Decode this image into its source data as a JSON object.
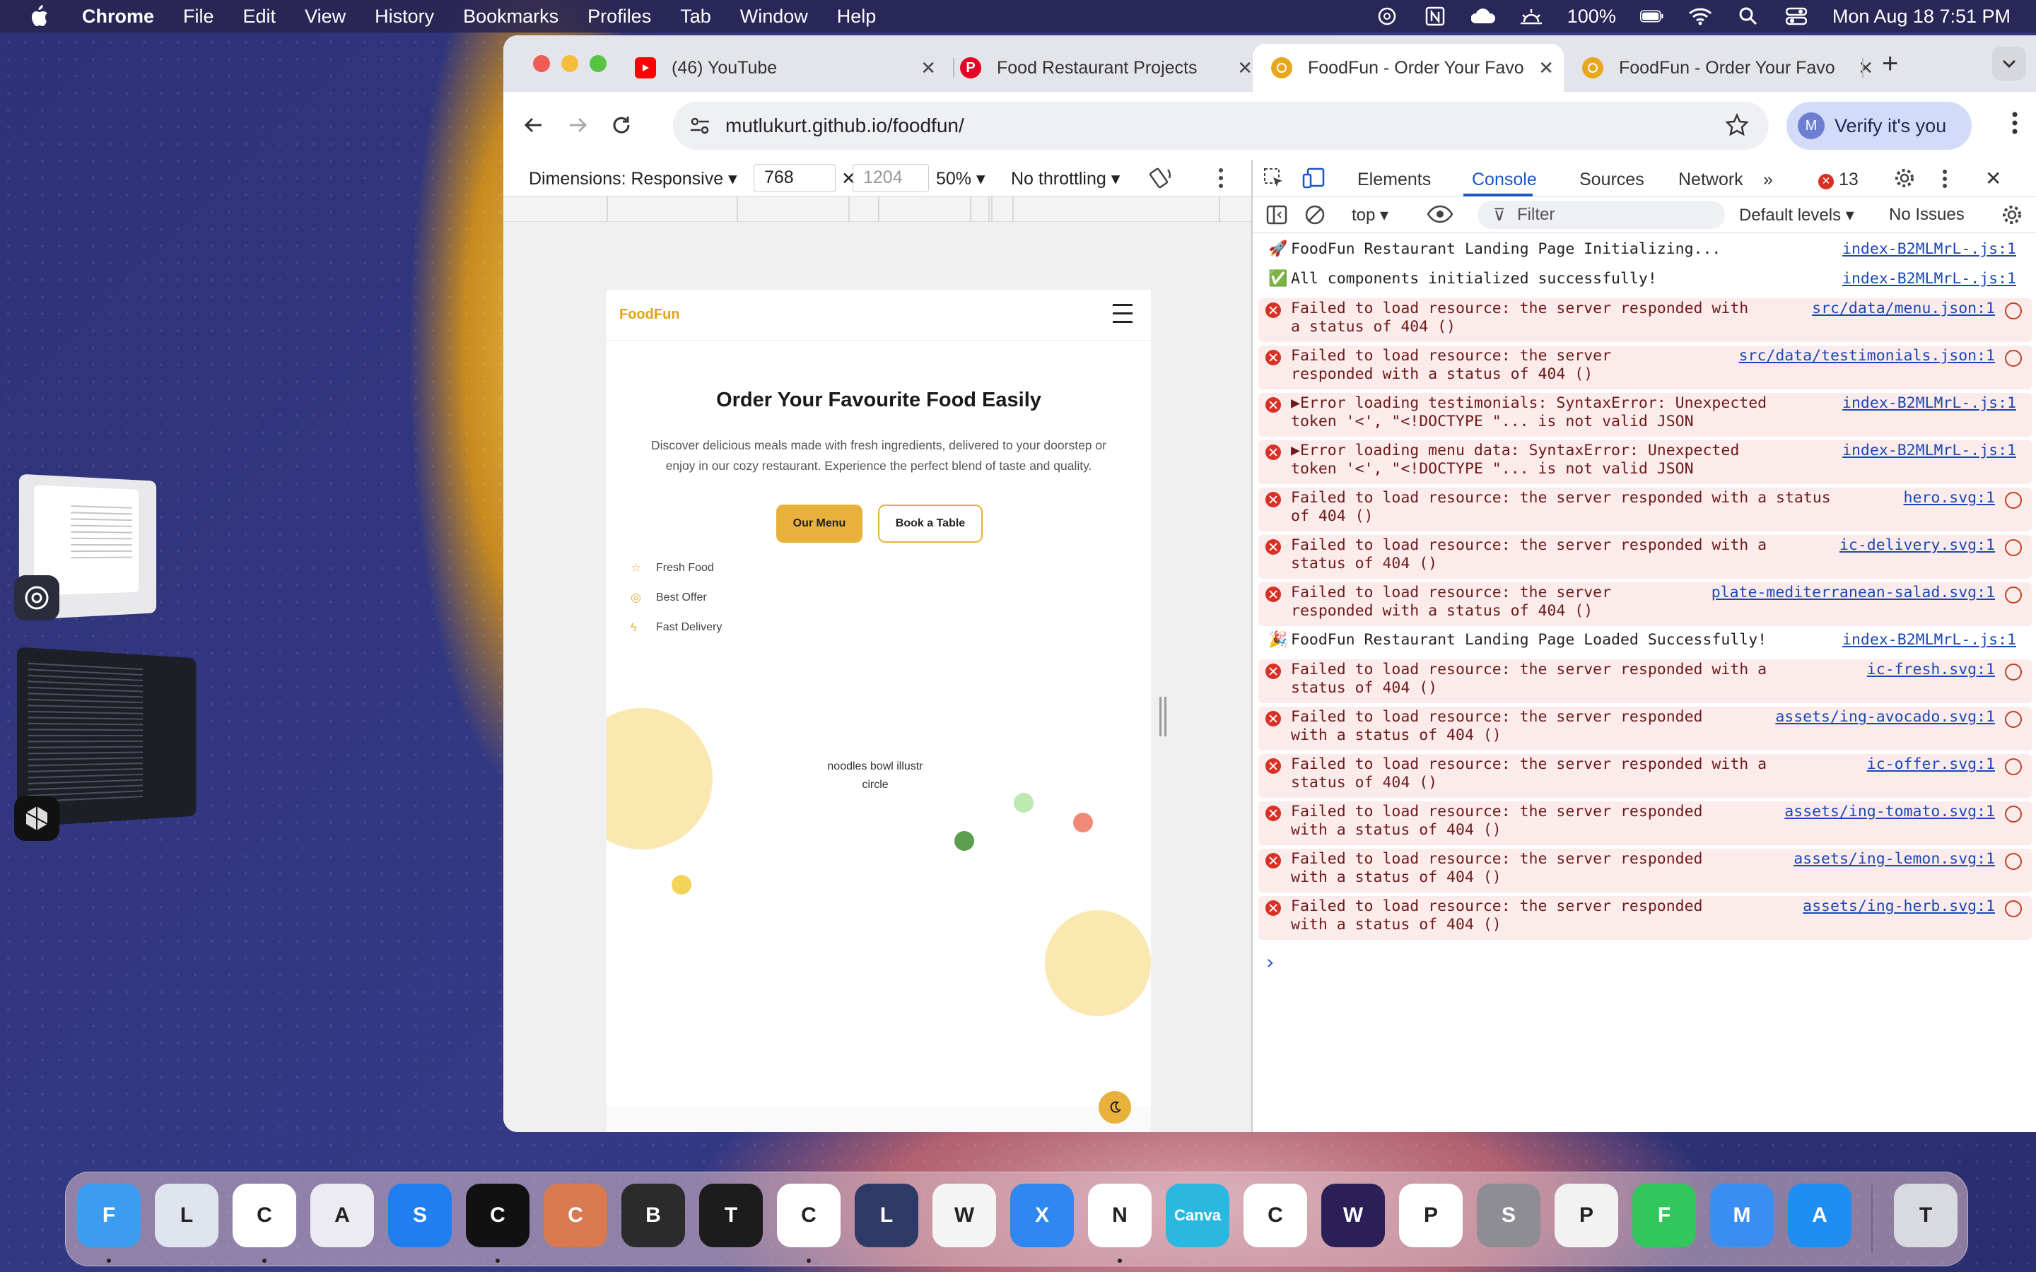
{
  "menubar": {
    "app": "Chrome",
    "items": [
      "File",
      "Edit",
      "View",
      "History",
      "Bookmarks",
      "Profiles",
      "Tab",
      "Window",
      "Help"
    ],
    "battery": "100%",
    "datetime": "Mon Aug 18  7:51 PM"
  },
  "tabs": [
    {
      "title": "(46) YouTube",
      "icon": "youtube-icon"
    },
    {
      "title": "Food Restaurant Projects",
      "icon": "pinterest-icon"
    },
    {
      "title": "FoodFun - Order Your Favo",
      "icon": "foodfun-icon",
      "active": true
    },
    {
      "title": "FoodFun - Order Your Favo",
      "icon": "foodfun-icon"
    }
  ],
  "omnibox": {
    "url": "mutlukurt.github.io/foodfun/"
  },
  "profile": {
    "initial": "M",
    "label": "Verify it's you"
  },
  "device_toolbar": {
    "dimensions": "Dimensions: Responsive",
    "width": "768",
    "height": "1204",
    "zoom": "50%",
    "throttling": "No throttling"
  },
  "page": {
    "brand": "FoodFun",
    "title": "Order Your Favourite Food Easily",
    "description_line1": "Discover delicious meals made with fresh ingredients, delivered to your doorstep or",
    "description_line2": "enjoy in our cozy restaurant. Experience the perfect blend of taste and quality.",
    "btn_menu": "Our Menu",
    "btn_book": "Book a Table",
    "features": [
      "Fresh Food",
      "Best Offer",
      "Fast Delivery"
    ],
    "image_alt_line1": "noodles bowl illustr",
    "image_alt_line2": "circle",
    "accent": "#e8b13c"
  },
  "devtools": {
    "tabs": [
      "Elements",
      "Console",
      "Sources",
      "Network"
    ],
    "error_count": "13",
    "context": "top",
    "filter_placeholder": "Filter",
    "levels": "Default levels",
    "issues": "No Issues",
    "rows": [
      {
        "type": "info",
        "emoji": "🚀",
        "lines": [
          "FoodFun Restaurant Landing Page Initializing..."
        ],
        "src": "index-B2MLMrL-.js:1"
      },
      {
        "type": "info",
        "emoji": "✅",
        "lines": [
          "All components initialized successfully!"
        ],
        "src": "index-B2MLMrL-.js:1"
      },
      {
        "type": "error",
        "lines": [
          "Failed to load resource: the server responded with",
          "a status of 404 ()"
        ],
        "src": "src/data/menu.json:1"
      },
      {
        "type": "error",
        "lines": [
          "Failed to load resource: the server",
          "responded with a status of 404 ()"
        ],
        "src": "src/data/testimonials.json:1"
      },
      {
        "type": "error",
        "expand": true,
        "lines": [
          "Error loading testimonials: SyntaxError: Unexpected",
          "token '<', \"<!DOCTYPE \"... is not valid JSON"
        ],
        "src": "index-B2MLMrL-.js:1"
      },
      {
        "type": "error",
        "expand": true,
        "lines": [
          "Error loading menu data: SyntaxError: Unexpected",
          "token '<', \"<!DOCTYPE \"... is not valid JSON"
        ],
        "src": "index-B2MLMrL-.js:1"
      },
      {
        "type": "error",
        "lines": [
          "Failed to load resource: the server responded with a status",
          "of 404 ()"
        ],
        "src": "hero.svg:1"
      },
      {
        "type": "error",
        "lines": [
          "Failed to load resource: the server responded with a",
          "status of 404 ()"
        ],
        "src": "ic-delivery.svg:1"
      },
      {
        "type": "error",
        "lines": [
          "Failed to load resource: the server",
          "responded with a status of 404 ()"
        ],
        "src": "plate-mediterranean-salad.svg:1"
      },
      {
        "type": "info",
        "emoji": "🎉",
        "lines": [
          "FoodFun Restaurant Landing Page Loaded Successfully!"
        ],
        "src": "index-B2MLMrL-.js:1"
      },
      {
        "type": "error",
        "lines": [
          "Failed to load resource: the server responded with a",
          "status of 404 ()"
        ],
        "src": "ic-fresh.svg:1"
      },
      {
        "type": "error",
        "lines": [
          "Failed to load resource: the server responded",
          "with a status of 404 ()"
        ],
        "src": "assets/ing-avocado.svg:1"
      },
      {
        "type": "error",
        "lines": [
          "Failed to load resource: the server responded with a",
          "status of 404 ()"
        ],
        "src": "ic-offer.svg:1"
      },
      {
        "type": "error",
        "lines": [
          "Failed to load resource: the server responded",
          "with a status of 404 ()"
        ],
        "src": "assets/ing-tomato.svg:1"
      },
      {
        "type": "error",
        "lines": [
          "Failed to load resource: the server responded",
          "with a status of 404 ()"
        ],
        "src": "assets/ing-lemon.svg:1"
      },
      {
        "type": "error",
        "lines": [
          "Failed to load resource: the server responded",
          "with a status of 404 ()"
        ],
        "src": "assets/ing-herb.svg:1"
      }
    ]
  },
  "dock": {
    "apps": [
      {
        "name": "finder",
        "color": "#3b9cf0",
        "running": true
      },
      {
        "name": "launchpad",
        "color": "#e0e4ee"
      },
      {
        "name": "chrome",
        "color": "#ffffff",
        "running": true
      },
      {
        "name": "affinity",
        "color": "#ecebf2"
      },
      {
        "name": "safari",
        "color": "#1f7ef0"
      },
      {
        "name": "cursor",
        "color": "#111111",
        "running": true
      },
      {
        "name": "claude",
        "color": "#d9794f"
      },
      {
        "name": "box-app",
        "color": "#2b2b2b"
      },
      {
        "name": "terminal",
        "color": "#1c1c1c"
      },
      {
        "name": "chatgpt",
        "color": "#ffffff",
        "running": true
      },
      {
        "name": "linear",
        "color": "#2e3a66"
      },
      {
        "name": "warp",
        "color": "#f4f4f4"
      },
      {
        "name": "xcode",
        "color": "#2f88ef"
      },
      {
        "name": "notion",
        "color": "#ffffff",
        "running": true
      },
      {
        "name": "canva",
        "color": "#2bb8e0",
        "label": "Canva"
      },
      {
        "name": "capcut",
        "color": "#ffffff"
      },
      {
        "name": "wondershare",
        "color": "#2a1f57"
      },
      {
        "name": "photos",
        "color": "#ffffff"
      },
      {
        "name": "settings",
        "color": "#8d8d93"
      },
      {
        "name": "preview",
        "color": "#f2f2f2"
      },
      {
        "name": "facetime",
        "color": "#32c65b"
      },
      {
        "name": "mail",
        "color": "#3a8ef2"
      },
      {
        "name": "app-store",
        "color": "#1f8ef2"
      },
      {
        "name": "trash",
        "color": "#d8dadf"
      }
    ]
  }
}
